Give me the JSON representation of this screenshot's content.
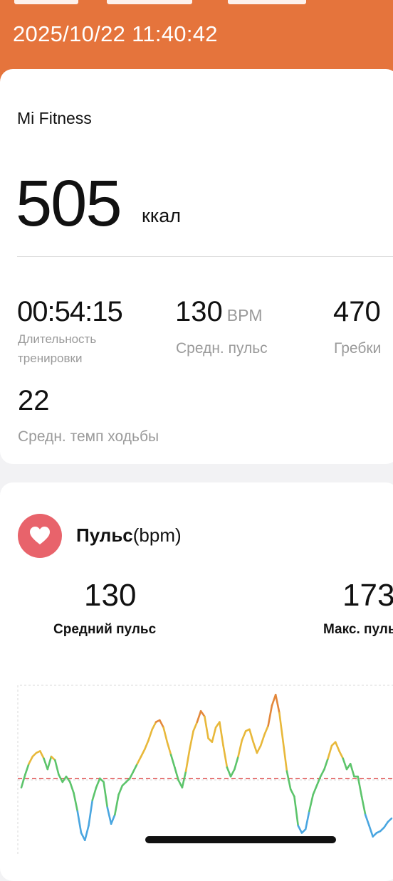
{
  "header": {
    "timestamp": "2025/10/22 11:40:42"
  },
  "summary": {
    "app_name": "Mi Fitness",
    "calories": {
      "value": "505",
      "unit": "ккал"
    },
    "stats": [
      {
        "value": "00:54:15",
        "unit": "",
        "label": "Длительность\nтренировки"
      },
      {
        "value": "130",
        "unit": "BPM",
        "label": "Средн. пульс"
      },
      {
        "value": "470",
        "unit": "",
        "label": "Гребки"
      },
      {
        "value": "22",
        "unit": "",
        "label": "Средн. темп ходьбы"
      }
    ]
  },
  "pulse": {
    "title_bold": "Пульс",
    "title_unit": "(bpm)",
    "avg": {
      "value": "130",
      "label": "Средний пульс"
    },
    "max": {
      "value": "173",
      "label": "Макс. пульс"
    },
    "colors": {
      "badge": "#e8636b",
      "zone_high": "#e3873a",
      "zone_mid": "#e8b83a",
      "zone_low": "#5cc46b",
      "zone_rest": "#4aa6e0",
      "avg_line": "#e05a5a"
    }
  },
  "chart_data": {
    "type": "line",
    "title": "",
    "xlabel": "",
    "ylabel": "",
    "ylim": [
      90,
      180
    ],
    "reference_lines": [
      {
        "label": "avg",
        "value": 130,
        "style": "dashed",
        "color": "#e05a5a"
      }
    ],
    "series": [
      {
        "values": [
          125,
          132,
          138,
          142,
          144,
          145,
          141,
          135,
          142,
          140,
          132,
          128,
          131,
          128,
          122,
          112,
          100,
          96,
          104,
          118,
          125,
          130,
          128,
          114,
          105,
          110,
          121,
          126,
          128,
          130,
          134,
          138,
          142,
          146,
          151,
          157,
          161,
          162,
          158,
          150,
          143,
          136,
          129,
          125,
          134,
          146,
          156,
          161,
          167,
          164,
          152,
          150,
          158,
          161,
          148,
          136,
          131,
          135,
          142,
          151,
          156,
          157,
          150,
          144,
          148,
          154,
          159,
          170,
          176,
          166,
          150,
          134,
          124,
          120,
          104,
          100,
          102,
          112,
          121,
          126,
          131,
          135,
          141,
          148,
          150,
          145,
          141,
          135,
          138,
          131,
          131,
          120,
          110,
          104,
          98,
          100,
          101,
          103,
          106,
          108
        ]
      }
    ]
  }
}
